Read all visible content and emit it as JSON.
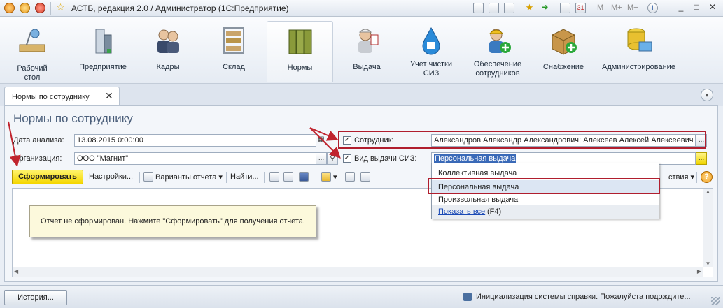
{
  "window": {
    "title": "АСТБ, редакция 2.0 / Администратор  (1С:Предприятие)",
    "toolbar_text_icons": [
      "M",
      "M+",
      "M−"
    ]
  },
  "sections": [
    {
      "label": "Рабочий стол",
      "icon": "desk-lamp-icon"
    },
    {
      "label": "Предприятие",
      "icon": "building-icon"
    },
    {
      "label": "Кадры",
      "icon": "people-icon"
    },
    {
      "label": "Склад",
      "icon": "warehouse-shelves-icon"
    },
    {
      "label": "Нормы",
      "icon": "binders-icon"
    },
    {
      "label": "Выдача",
      "icon": "worker-icon"
    },
    {
      "label": "Учет чистки СИЗ",
      "icon": "drop-shirt-icon"
    },
    {
      "label": "Обеспечение сотрудников",
      "icon": "worker-add-icon"
    },
    {
      "label": "Снабжение",
      "icon": "box-add-icon"
    },
    {
      "label": "Администрирование",
      "icon": "admin-db-icon"
    }
  ],
  "active_section": "Нормы",
  "tab": {
    "label": "Нормы по сотруднику",
    "close": "✕"
  },
  "form": {
    "title": "Нормы по сотруднику",
    "date_label": "Дата анализа:",
    "date_value": "13.08.2015  0:00:00",
    "org_label": "Организация:",
    "org_value": "ООО \"Магнит\"",
    "employee_label": "Сотрудник:",
    "employee_checked": true,
    "employee_value": "Александров Александр Александрович; Алексеев Алексей Алексеевич",
    "issue_type_label": "Вид выдачи СИЗ:",
    "issue_type_checked": true,
    "issue_type_value": "Персональная выдача",
    "ellipsis": "..."
  },
  "toolbar": {
    "generate": "Сформировать",
    "settings": "Настройки...",
    "variants": "Варианты отчета",
    "find": "Найти...",
    "actions": "ствия",
    "help": "?"
  },
  "report": {
    "message": "Отчет не сформирован. Нажмите \"Сформировать\" для получения отчета."
  },
  "dropdown": {
    "items": [
      "Коллективная выдача",
      "Персональная выдача",
      "Произвольная выдача"
    ],
    "selected_index": 1,
    "show_all": "Показать все",
    "show_all_key": "(F4)"
  },
  "statusbar": {
    "history": "История...",
    "message": "Инициализация системы справки. Пожалуйста подождите..."
  },
  "colors": {
    "highlight_box": "#b01e2e",
    "generate_button": "#f4d600",
    "accent_title": "#4a5e7a"
  }
}
